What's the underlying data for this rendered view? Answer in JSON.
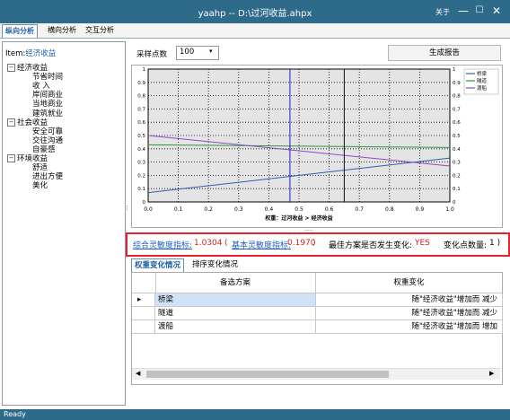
{
  "window": {
    "title": "yaahp -- D:\\过河收益.ahpx",
    "about": "关于",
    "minimize": "—",
    "maximize": "☐",
    "close": "✕"
  },
  "tabs": [
    {
      "label": "纵向分析",
      "active": true
    },
    {
      "label": "横向分析",
      "active": false
    },
    {
      "label": "交互分析",
      "active": false
    }
  ],
  "left": {
    "item_prefix": "Item:",
    "item_value": "经济收益",
    "tree": [
      {
        "label": "经济收益",
        "level": 0,
        "toggle": "−"
      },
      {
        "label": "节省时间",
        "level": 1
      },
      {
        "label": "收  入",
        "level": 1
      },
      {
        "label": "岸间商业",
        "level": 1
      },
      {
        "label": "当地商业",
        "level": 1
      },
      {
        "label": "建筑就业",
        "level": 1
      },
      {
        "label": "社会收益",
        "level": 0,
        "toggle": "−"
      },
      {
        "label": "安全可靠",
        "level": 1
      },
      {
        "label": "交往沟通",
        "level": 1
      },
      {
        "label": "自豪感",
        "level": 1
      },
      {
        "label": "环境收益",
        "level": 0,
        "toggle": "−"
      },
      {
        "label": "舒适",
        "level": 1
      },
      {
        "label": "进出方便",
        "level": 1
      },
      {
        "label": "美化",
        "level": 1
      }
    ]
  },
  "controls": {
    "sample_label": "采样点数",
    "sample_value": "100",
    "generate": "生成报告"
  },
  "chart_data": {
    "type": "line",
    "xlabel": "权重：过河收益 > 经济收益",
    "xlim": [
      0,
      1
    ],
    "ylim": [
      0,
      1
    ],
    "x_ticks": [
      "0.0",
      "0.1",
      "0.2",
      "0.3",
      "0.4",
      "0.5",
      "0.6",
      "0.7",
      "0.8",
      "0.9",
      "1.0"
    ],
    "y_ticks_left": [
      "0",
      "0.1",
      "0.2",
      "0.3",
      "0.4",
      "0.5",
      "0.6",
      "0.7",
      "0.8",
      "0.9",
      "1"
    ],
    "y_ticks_right": [
      "0",
      "0.1",
      "0.2",
      "0.3",
      "0.4",
      "0.5",
      "0.6",
      "0.7",
      "0.8",
      "0.9",
      "1"
    ],
    "series": [
      {
        "name": "桥梁",
        "color": "#2a60b0",
        "x": [
          0,
          1
        ],
        "y": [
          0.07,
          0.33
        ]
      },
      {
        "name": "隧道",
        "color": "#2e9a3a",
        "x": [
          0,
          1
        ],
        "y": [
          0.43,
          0.41
        ]
      },
      {
        "name": "渡船",
        "color": "#8a4ac8",
        "x": [
          0,
          1
        ],
        "y": [
          0.5,
          0.27
        ]
      }
    ],
    "vlines": [
      {
        "x": 0.47,
        "color": "#1a1acc"
      },
      {
        "x": 0.65,
        "color": "#111111"
      }
    ],
    "grid": true,
    "legend": "top-right"
  },
  "stats": {
    "label1": "综合灵敏度指标:",
    "value1": "1.0304",
    "open_paren": "(",
    "label2": "基本灵敏度指标:",
    "value2": "0.1970",
    "close_paren": ")",
    "label3": "最佳方案是否发生变化:",
    "value3": "YES",
    "label4": "变化点数量:",
    "value4": "1 )"
  },
  "subtabs": [
    {
      "label": "权重变化情况",
      "active": true
    },
    {
      "label": "排序变化情况",
      "active": false
    }
  ],
  "table": {
    "headers": [
      "备选方案",
      "权重变化"
    ],
    "rows": [
      {
        "name": "桥梁",
        "change": "随\"经济收益\"增加而 减少",
        "current": true
      },
      {
        "name": "隧道",
        "change": "随\"经济收益\"增加而 减少",
        "current": false
      },
      {
        "name": "渡船",
        "change": "随\"经济收益\"增加而 增加",
        "current": false
      }
    ]
  },
  "status": {
    "text": "Ready"
  }
}
